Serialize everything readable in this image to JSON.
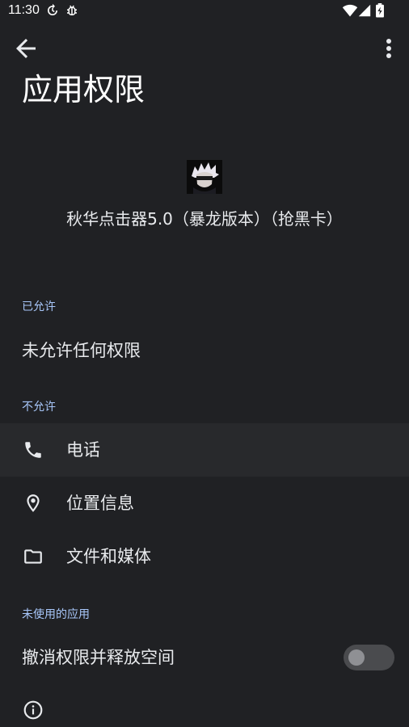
{
  "status_bar": {
    "time": "11:30",
    "icons": [
      "sync-icon",
      "bug-icon",
      "wifi-icon",
      "signal-icon",
      "battery-charging-icon"
    ]
  },
  "app_bar": {
    "back_icon": "arrow-back-icon",
    "more_icon": "more-vert-icon"
  },
  "page": {
    "title": "应用权限"
  },
  "app": {
    "icon": "app-avatar",
    "name": "秋华点击器5.0（暴龙版本）（抢黑卡）"
  },
  "allowed": {
    "header": "已允许",
    "empty_text": "未允许任何权限"
  },
  "not_allowed": {
    "header": "不允许",
    "items": [
      {
        "label": "电话",
        "icon": "phone-icon"
      },
      {
        "label": "位置信息",
        "icon": "location-icon"
      },
      {
        "label": "文件和媒体",
        "icon": "folder-icon"
      }
    ]
  },
  "unused_apps": {
    "header": "未使用的应用",
    "toggle_label": "撤消权限并释放空间",
    "toggle_on": false
  },
  "footer": {
    "icon": "info-icon"
  },
  "colors": {
    "background": "#202124",
    "section_header": "#a8c7fa",
    "text": "#e8eaed"
  }
}
